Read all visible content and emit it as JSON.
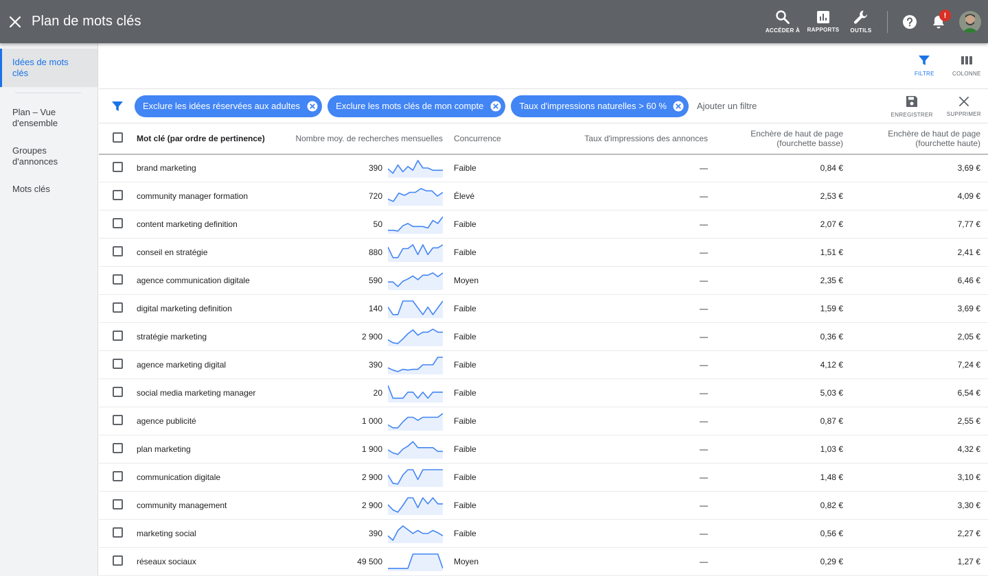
{
  "header": {
    "title": "Plan de mots clés",
    "actions": [
      {
        "label": "ACCÉDER À",
        "icon": "search-icon"
      },
      {
        "label": "RAPPORTS",
        "icon": "bar-chart-icon"
      },
      {
        "label": "OUTILS",
        "icon": "wrench-icon"
      }
    ],
    "notification_badge": "!"
  },
  "sidebar": {
    "items": [
      {
        "label": "Idées de mots clés",
        "active": true
      },
      {
        "label": "Plan – Vue d'ensemble",
        "active": false
      },
      {
        "label": "Groupes d'annonces",
        "active": false
      },
      {
        "label": "Mots clés",
        "active": false
      }
    ]
  },
  "view_toolbar": {
    "filter_label": "FILTRE",
    "columns_label": "COLONNE"
  },
  "filter_bar": {
    "chips": [
      "Exclure les idées réservées aux adultes",
      "Exclure les mots clés de mon compte",
      "Taux d'impressions naturelles > 60 %"
    ],
    "add_filter": "Ajouter un filtre",
    "save_label": "ENREGISTRER",
    "delete_label": "SUPPRIMER"
  },
  "table": {
    "headers": {
      "keyword": "Mot clé (par ordre de pertinence)",
      "volume": "Nombre moy. de recherches mensuelles",
      "competition": "Concurrence",
      "impression_share": "Taux d'impressions des annonces",
      "bid_low_1": "Enchère de haut de page",
      "bid_low_2": "(fourchette basse)",
      "bid_high_1": "Enchère de haut de page",
      "bid_high_2": "(fourchette haute)"
    },
    "rows": [
      {
        "keyword": "brand marketing",
        "volume": "390",
        "competition": "Faible",
        "impr": "—",
        "low": "0,84 €",
        "high": "3,69 €",
        "trend": [
          0.45,
          0.15,
          0.7,
          0.25,
          0.6,
          0.35,
          1.0,
          0.5,
          0.5,
          0.35,
          0.35,
          0.35
        ]
      },
      {
        "keyword": "community manager formation",
        "volume": "720",
        "competition": "Élevé",
        "impr": "—",
        "low": "2,53 €",
        "high": "4,09 €",
        "trend": [
          0.3,
          0.15,
          0.7,
          0.55,
          0.75,
          0.75,
          1.0,
          0.85,
          0.85,
          0.5,
          0.75
        ]
      },
      {
        "keyword": "content marketing definition",
        "volume": "50",
        "competition": "Faible",
        "impr": "—",
        "low": "2,07 €",
        "high": "7,77 €",
        "trend": [
          0.1,
          0.1,
          0.05,
          0.4,
          0.55,
          0.35,
          0.35,
          0.35,
          0.25,
          0.75,
          0.55,
          1.0
        ]
      },
      {
        "keyword": "conseil en stratégie",
        "volume": "880",
        "competition": "Faible",
        "impr": "—",
        "low": "1,51 €",
        "high": "2,41 €",
        "trend": [
          0.85,
          0.15,
          0.15,
          0.75,
          0.75,
          1.0,
          0.35,
          1.0,
          0.35,
          0.8,
          0.8,
          1.0
        ]
      },
      {
        "keyword": "agence communication digitale",
        "volume": "590",
        "competition": "Moyen",
        "impr": "—",
        "low": "2,35 €",
        "high": "6,46 €",
        "trend": [
          0.4,
          0.4,
          0.1,
          0.45,
          0.6,
          0.8,
          0.55,
          0.85,
          0.85,
          1.0,
          0.75,
          1.0
        ]
      },
      {
        "keyword": "digital marketing definition",
        "volume": "140",
        "competition": "Faible",
        "impr": "—",
        "low": "1,59 €",
        "high": "3,69 €",
        "trend": [
          0.6,
          0.1,
          0.1,
          1.0,
          1.0,
          1.0,
          0.55,
          0.1,
          0.6,
          0.1,
          0.55,
          1.0
        ]
      },
      {
        "keyword": "stratégie marketing",
        "volume": "2 900",
        "competition": "Faible",
        "impr": "—",
        "low": "0,36 €",
        "high": "2,05 €",
        "trend": [
          0.3,
          0.1,
          0.05,
          0.35,
          0.7,
          0.95,
          0.6,
          0.8,
          0.8,
          1.0,
          0.8,
          0.8
        ]
      },
      {
        "keyword": "agence marketing digital",
        "volume": "390",
        "competition": "Faible",
        "impr": "—",
        "low": "4,12 €",
        "high": "7,24 €",
        "trend": [
          0.3,
          0.15,
          0.05,
          0.2,
          0.15,
          0.2,
          0.2,
          0.5,
          0.5,
          0.5,
          1.0,
          1.0
        ]
      },
      {
        "keyword": "social media marketing manager",
        "volume": "20",
        "competition": "Faible",
        "impr": "—",
        "low": "5,03 €",
        "high": "6,54 €",
        "trend": [
          1.0,
          0.15,
          0.15,
          0.15,
          0.55,
          0.55,
          0.15,
          0.55,
          0.15,
          0.55,
          0.55,
          0.55
        ]
      },
      {
        "keyword": "agence publicité",
        "volume": "1 000",
        "competition": "Faible",
        "impr": "—",
        "low": "0,87 €",
        "high": "2,55 €",
        "trend": [
          0.25,
          0.05,
          0.05,
          0.45,
          0.75,
          0.75,
          0.55,
          0.75,
          0.75,
          0.75,
          0.75,
          1.0
        ]
      },
      {
        "keyword": "plan marketing",
        "volume": "1 900",
        "competition": "Faible",
        "impr": "—",
        "low": "1,03 €",
        "high": "4,32 €",
        "trend": [
          0.45,
          0.25,
          0.15,
          0.5,
          0.7,
          1.0,
          0.6,
          0.6,
          0.6,
          0.6,
          0.35,
          0.35
        ]
      },
      {
        "keyword": "communication digitale",
        "volume": "2 900",
        "competition": "Faible",
        "impr": "—",
        "low": "1,48 €",
        "high": "3,10 €",
        "trend": [
          0.65,
          0.1,
          0.05,
          0.65,
          1.0,
          1.0,
          0.35,
          1.0,
          1.0,
          1.0,
          1.0,
          1.0
        ]
      },
      {
        "keyword": "community management",
        "volume": "2 900",
        "competition": "Faible",
        "impr": "—",
        "low": "0,82 €",
        "high": "3,30 €",
        "trend": [
          0.55,
          0.2,
          0.05,
          0.5,
          1.0,
          1.0,
          0.35,
          1.0,
          0.6,
          1.0,
          0.6,
          0.6
        ]
      },
      {
        "keyword": "marketing social",
        "volume": "390",
        "competition": "Faible",
        "impr": "—",
        "low": "0,56 €",
        "high": "2,27 €",
        "trend": [
          0.35,
          0.05,
          0.7,
          1.0,
          0.75,
          0.5,
          0.7,
          0.5,
          0.5,
          0.7,
          0.55,
          0.35
        ]
      },
      {
        "keyword": "réseaux sociaux",
        "volume": "49 500",
        "competition": "Moyen",
        "impr": "—",
        "low": "0,29 €",
        "high": "1,27 €",
        "trend": [
          0.05,
          0.05,
          0.05,
          0.05,
          0.05,
          1.0,
          1.0,
          1.0,
          1.0,
          1.0,
          1.0,
          0.05
        ]
      }
    ]
  },
  "colors": {
    "topbar": "#5f6368",
    "accent": "#1a73e8",
    "chip": "#4285f4",
    "spark_line": "#4285f4",
    "spark_fill": "#e8f0fe",
    "badge": "#d93025"
  }
}
